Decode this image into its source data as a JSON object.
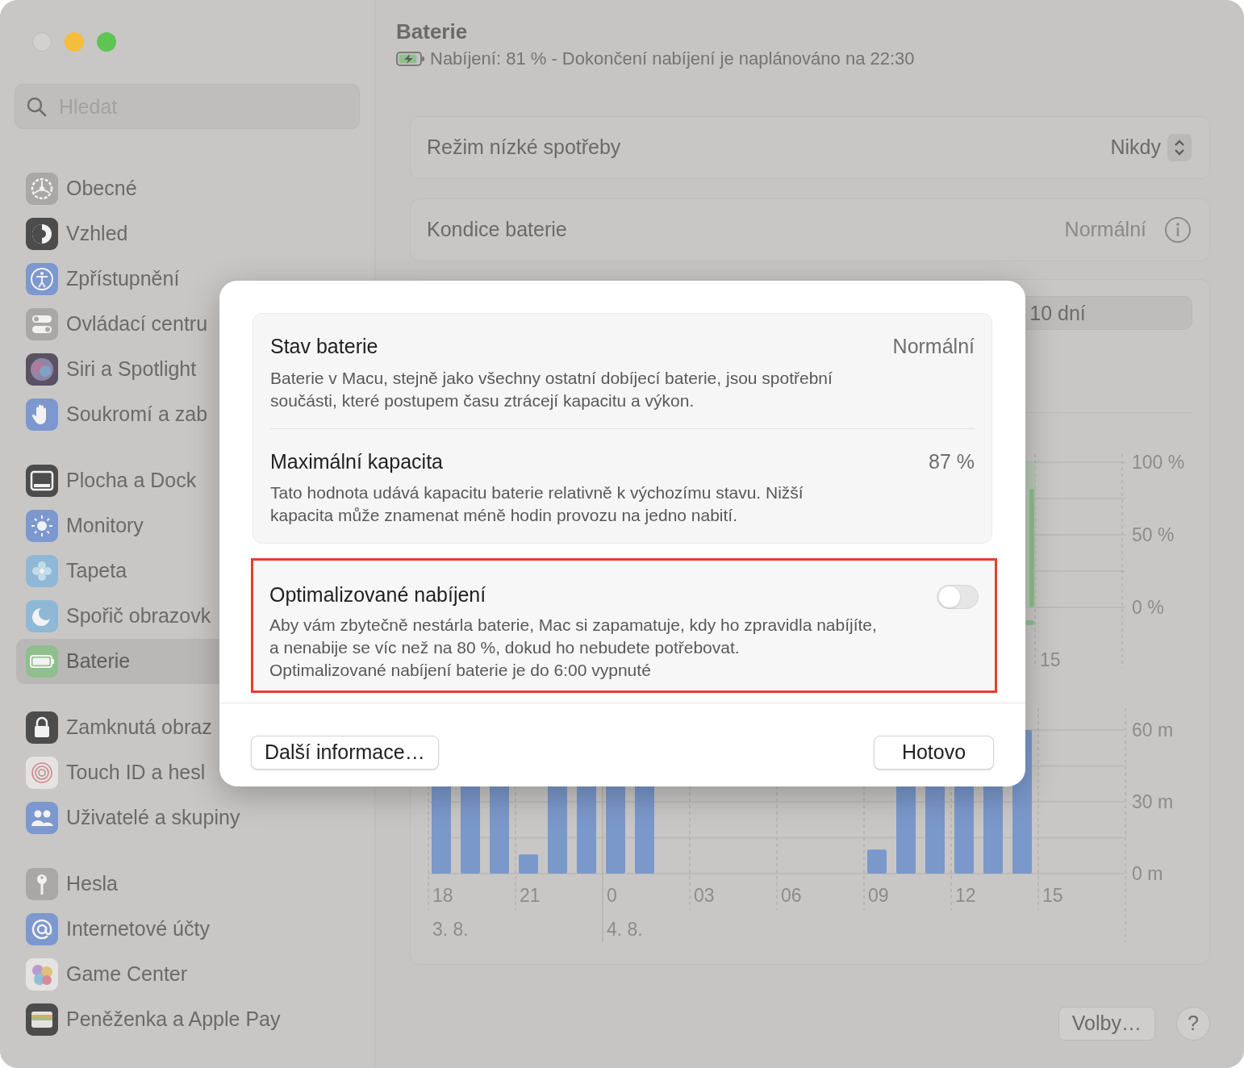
{
  "sidebar": {
    "search": {
      "placeholder": "Hledat"
    },
    "groups": [
      {
        "items": [
          {
            "label": "Obecné",
            "selected": false
          },
          {
            "label": "Vzhled",
            "selected": false
          },
          {
            "label": "Zpřístupnění",
            "selected": false
          },
          {
            "label": "Ovládací centru",
            "selected": false
          },
          {
            "label": "Siri a Spotlight",
            "selected": false
          },
          {
            "label": "Soukromí a zab",
            "selected": false
          }
        ]
      },
      {
        "items": [
          {
            "label": "Plocha a Dock",
            "selected": false
          },
          {
            "label": "Monitory",
            "selected": false
          },
          {
            "label": "Tapeta",
            "selected": false
          },
          {
            "label": "Spořič obrazovk",
            "selected": false
          },
          {
            "label": "Baterie",
            "selected": true
          }
        ]
      },
      {
        "items": [
          {
            "label": "Zamknutá obraz",
            "selected": false
          },
          {
            "label": "Touch ID a hesl",
            "selected": false
          },
          {
            "label": "Uživatelé a skupiny",
            "selected": false
          }
        ]
      },
      {
        "items": [
          {
            "label": "Hesla",
            "selected": false
          },
          {
            "label": "Internetové účty",
            "selected": false
          },
          {
            "label": "Game Center",
            "selected": false
          },
          {
            "label": "Peněženka a Apple Pay",
            "selected": false
          }
        ]
      }
    ]
  },
  "header": {
    "title": "Baterie",
    "status": "Nabíjení: 81 % - Dokončení nabíjení je naplánováno na 22:30"
  },
  "settings": [
    {
      "kind": "popup",
      "label": "Režim nízké spotřeby",
      "value": "Nikdy"
    },
    {
      "kind": "info",
      "label": "Kondice baterie",
      "value": "Normální"
    }
  ],
  "history": {
    "segment": "10 dní",
    "battery_chart": {
      "y_labels": [
        "100 %",
        "50 %",
        "0 %"
      ],
      "x_labels": [
        "15"
      ]
    },
    "usage_chart": {
      "y_labels": [
        "60 m",
        "30 m",
        "0 m"
      ],
      "x_labels": [
        "18",
        "21",
        "0",
        "03",
        "06",
        "09",
        "12",
        "15"
      ],
      "date_labels": [
        "3. 8.",
        "4. 8."
      ]
    }
  },
  "footer_buttons": [
    {
      "kind": "text",
      "label": "Volby…"
    },
    {
      "kind": "help",
      "label": "?"
    }
  ],
  "dialog": {
    "info_rows": [
      {
        "title": "Stav baterie",
        "value": "Normální",
        "description": "Baterie v Macu, stejně jako všechny ostatní dobíjecí baterie, jsou spotřební součásti, které postupem času ztrácejí kapacitu a výkon."
      },
      {
        "title": "Maximální kapacita",
        "value": "87 %",
        "description": "Tato hodnota udává kapacitu baterie relativně k výchozímu stavu. Nižší kapacita může znamenat méně hodin provozu na jedno nabití."
      }
    ],
    "toggle_row": {
      "title": "Optimalizované nabíjení",
      "on": false,
      "highlighted": true,
      "description": "Aby vám zbytečně nestárla baterie, Mac si zapamatuje, kdy ho zpravidla nabíjíte, a nenabije se víc než na 80 %, dokud ho nebudete potřebovat.",
      "note": "Optimalizované nabíjení baterie je do 6:00 vypnuté"
    },
    "buttons": [
      {
        "label": "Další informace…"
      },
      {
        "label": "Hotovo"
      }
    ]
  }
}
